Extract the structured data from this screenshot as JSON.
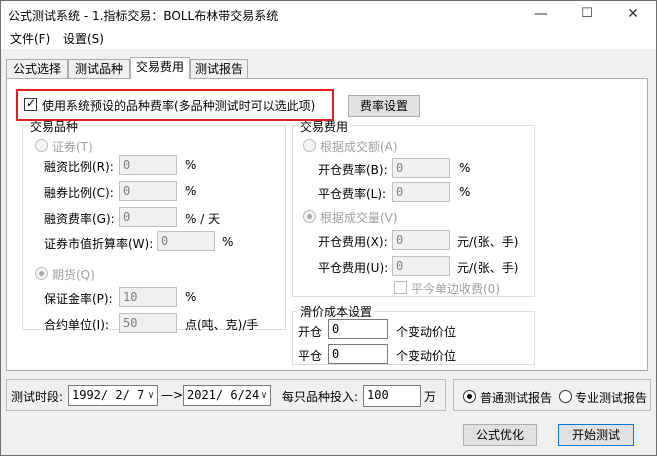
{
  "window": {
    "title": "公式测试系统 - 1.指标交易：BOLL布林带交易系统",
    "minimize": "—",
    "maximize": "☐",
    "close": "✕"
  },
  "menu": [
    "文件(F)",
    "设置(S)"
  ],
  "tabs": [
    "公式选择",
    "测试品种",
    "交易费用",
    "测试报告"
  ],
  "active_tab": "交易费用",
  "use_default_fee": {
    "label": "使用系统预设的品种费率(多品种测试时可以选此项)",
    "checked": true
  },
  "fee_settings_button": "费率设置",
  "trade_variety": {
    "title": "交易品种",
    "securities": {
      "label": "证券(T)",
      "fields": [
        {
          "label": "融资比例(R):",
          "value": "0",
          "unit": "%"
        },
        {
          "label": "融券比例(C):",
          "value": "0",
          "unit": "%"
        },
        {
          "label": "融资费率(G):",
          "value": "0",
          "unit": "% / 天"
        },
        {
          "label": "证券市值折算率(W):",
          "value": "0",
          "unit": "%"
        }
      ]
    },
    "futures": {
      "label": "期货(Q)",
      "selected": true,
      "fields": [
        {
          "label": "保证金率(P):",
          "value": "10",
          "unit": "%"
        },
        {
          "label": "合约单位(I):",
          "value": "50",
          "unit": "点(吨、克)/手"
        }
      ]
    }
  },
  "trade_fee": {
    "title": "交易费用",
    "by_amount": {
      "label": "根据成交额(A)",
      "fields": [
        {
          "label": "开仓费率(B):",
          "value": "0",
          "unit": "%"
        },
        {
          "label": "平仓费率(L):",
          "value": "0",
          "unit": "%"
        }
      ]
    },
    "by_volume": {
      "label": "根据成交量(V)",
      "selected": true,
      "fields": [
        {
          "label": "开仓费用(X):",
          "value": "0",
          "unit": "元/(张、手)"
        },
        {
          "label": "平仓费用(U):",
          "value": "0",
          "unit": "元/(张、手)"
        }
      ]
    },
    "close_today_single": "平今单边收费(0)"
  },
  "slippage": {
    "title": "滑价成本设置",
    "open_label": "开仓",
    "open_value": "0",
    "close_label": "平仓",
    "close_value": "0",
    "unit": "个变动价位"
  },
  "bottom": {
    "period_label": "测试时段:",
    "start_date": "1992/ 2/ 7",
    "arrow": "—>",
    "end_date": "2021/ 6/24",
    "invest_label": "每只品种投入:",
    "invest_value": "100",
    "invest_unit": "万",
    "report_normal": "普通测试报告",
    "report_pro": "专业测试报告",
    "report_selected": "普通测试报告",
    "optimize_button": "公式优化",
    "start_button": "开始测试"
  }
}
